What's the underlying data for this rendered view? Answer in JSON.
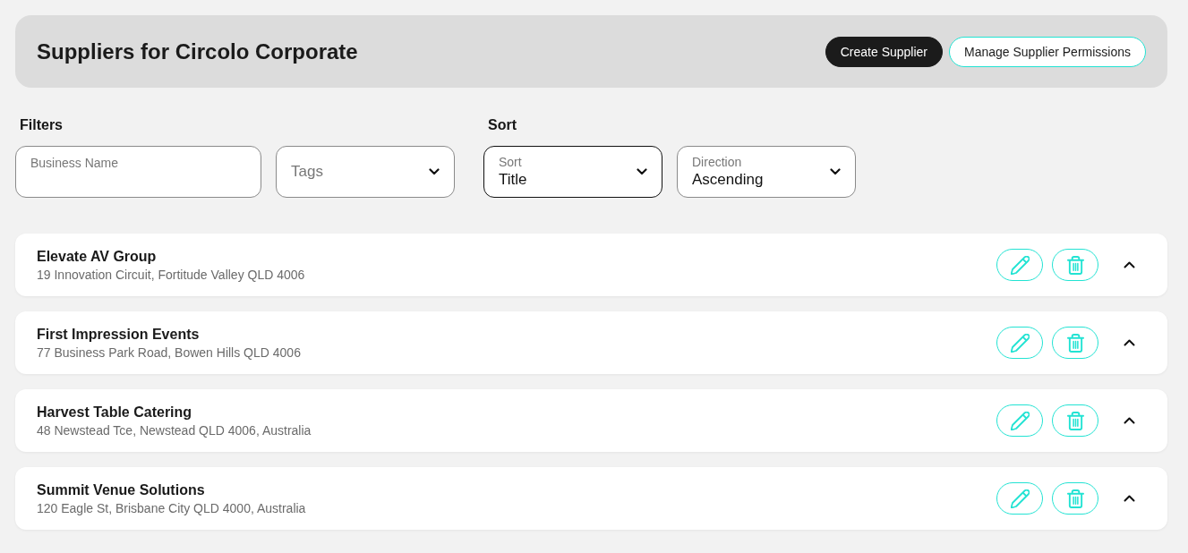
{
  "header": {
    "title": "Suppliers for Circolo Corporate",
    "buttons": [
      {
        "label": "Create Supplier",
        "kind": "primary"
      },
      {
        "label": "Manage Supplier Permissions",
        "kind": "outline"
      }
    ]
  },
  "filters": {
    "title": "Filters",
    "fields": [
      {
        "kind": "text",
        "label": "Business Name",
        "focused": false
      },
      {
        "kind": "select",
        "placeholder": "Tags",
        "focused": false
      }
    ]
  },
  "sort": {
    "title": "Sort",
    "fields": [
      {
        "kind": "select",
        "label": "Sort",
        "value": "Title",
        "focused": true
      },
      {
        "kind": "select",
        "label": "Direction",
        "value": "Ascending",
        "focused": false
      }
    ]
  },
  "suppliers": [
    {
      "name": "Elevate AV Group",
      "address": "19 Innovation Circuit, Fortitude Valley QLD 4006"
    },
    {
      "name": "First Impression Events",
      "address": "77 Business Park Road, Bowen Hills QLD 4006"
    },
    {
      "name": "Harvest Table Catering",
      "address": "48 Newstead Tce, Newstead QLD 4006, Australia"
    },
    {
      "name": "Summit Venue Solutions",
      "address": "120 Eagle St, Brisbane City QLD 4000, Australia"
    }
  ]
}
